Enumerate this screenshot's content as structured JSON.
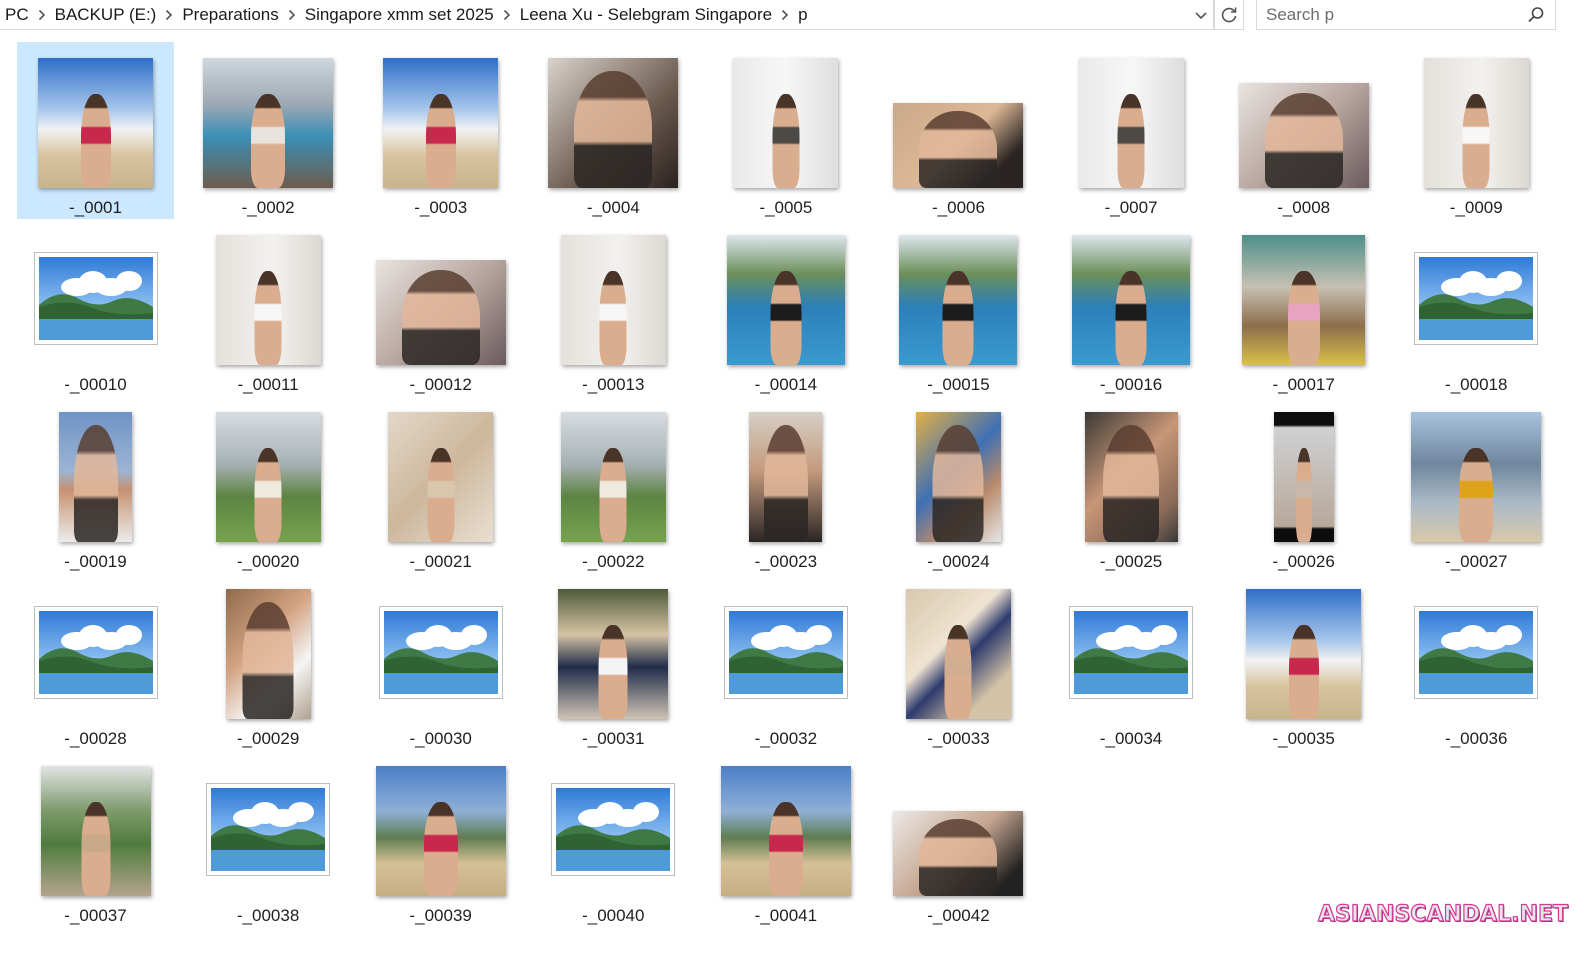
{
  "address_bar": {
    "breadcrumbs": [
      "PC",
      "BACKUP (E:)",
      "Preparations",
      "Singapore xmm set 2025",
      "Leena Xu - Selebgram Singapore",
      "p"
    ]
  },
  "search": {
    "placeholder": "Search p"
  },
  "selected_file": "-_0001",
  "files": [
    {
      "name": "-_0001",
      "thumb": "beach-bikini"
    },
    {
      "name": "-_0002",
      "thumb": "poolside-rooftop"
    },
    {
      "name": "-_0003",
      "thumb": "beach-bikini"
    },
    {
      "name": "-_0004",
      "thumb": "selfie-tattoo"
    },
    {
      "name": "-_0005",
      "thumb": "white-door-outfit"
    },
    {
      "name": "-_0006",
      "thumb": "selfie-black-top"
    },
    {
      "name": "-_0007",
      "thumb": "white-door-outfit"
    },
    {
      "name": "-_0008",
      "thumb": "selfie-closeup"
    },
    {
      "name": "-_0009",
      "thumb": "white-dress"
    },
    {
      "name": "-_00010",
      "thumb": "generic-picture"
    },
    {
      "name": "-_00011",
      "thumb": "white-dress"
    },
    {
      "name": "-_00012",
      "thumb": "selfie-closeup"
    },
    {
      "name": "-_00013",
      "thumb": "white-dress"
    },
    {
      "name": "-_00014",
      "thumb": "pool-black-bikini"
    },
    {
      "name": "-_00015",
      "thumb": "pool-black-bikini"
    },
    {
      "name": "-_00016",
      "thumb": "pool-black-bikini"
    },
    {
      "name": "-_00017",
      "thumb": "stairs-pink-top"
    },
    {
      "name": "-_00018",
      "thumb": "generic-picture"
    },
    {
      "name": "-_00019",
      "thumb": "white-tube-top"
    },
    {
      "name": "-_00020",
      "thumb": "field-white-dress"
    },
    {
      "name": "-_00021",
      "thumb": "stone-wall-dress"
    },
    {
      "name": "-_00022",
      "thumb": "field-white-dress"
    },
    {
      "name": "-_00023",
      "thumb": "portrait-black-top"
    },
    {
      "name": "-_00024",
      "thumb": "umbrella-selfie"
    },
    {
      "name": "-_00025",
      "thumb": "two-friends-selfie"
    },
    {
      "name": "-_00026",
      "thumb": "phone-mirror-photo"
    },
    {
      "name": "-_00027",
      "thumb": "lifeguard-tower"
    },
    {
      "name": "-_00028",
      "thumb": "generic-picture"
    },
    {
      "name": "-_00029",
      "thumb": "smiling-white-top"
    },
    {
      "name": "-_00030",
      "thumb": "generic-picture"
    },
    {
      "name": "-_00031",
      "thumb": "lounger-white-bikini"
    },
    {
      "name": "-_00032",
      "thumb": "generic-picture"
    },
    {
      "name": "-_00033",
      "thumb": "sand-towel"
    },
    {
      "name": "-_00034",
      "thumb": "generic-picture"
    },
    {
      "name": "-_00035",
      "thumb": "beach-bikini"
    },
    {
      "name": "-_00036",
      "thumb": "generic-picture"
    },
    {
      "name": "-_00037",
      "thumb": "park-crop-top"
    },
    {
      "name": "-_00038",
      "thumb": "generic-picture"
    },
    {
      "name": "-_00039",
      "thumb": "palm-beach-bikini"
    },
    {
      "name": "-_00040",
      "thumb": "generic-picture"
    },
    {
      "name": "-_00041",
      "thumb": "palm-beach-bikini"
    },
    {
      "name": "-_00042",
      "thumb": "portrait-headband"
    }
  ],
  "watermark": {
    "text": "ASIANSCANDAL.NET"
  },
  "colors": {
    "selection": "#cce8ff",
    "sky": "#3f7fd0",
    "pool": "#2f88c0",
    "sand": "#d8c29a",
    "bikini": "#c8284c"
  }
}
